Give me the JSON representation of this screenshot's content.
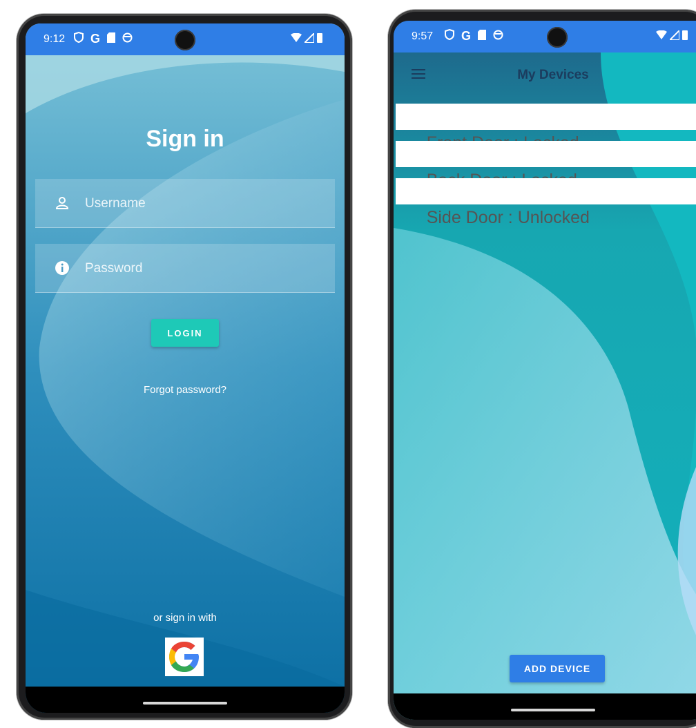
{
  "left_screen": {
    "status_bar": {
      "time": "9:12",
      "icons": [
        "shield-icon",
        "google-g-icon",
        "sd-card-icon",
        "circle-icon"
      ],
      "right_icons": [
        "wifi-icon",
        "signal-icon",
        "battery-icon"
      ]
    },
    "title": "Sign in",
    "username_placeholder": "Username",
    "password_placeholder": "Password",
    "login_label": "LOGIN",
    "forgot_password": "Forgot password?",
    "or_sign_in_with": "or sign in with",
    "google_button_icon": "google-logo-icon"
  },
  "right_screen": {
    "status_bar": {
      "time": "9:57",
      "icons": [
        "shield-icon",
        "google-g-icon",
        "sd-card-icon",
        "circle-icon"
      ],
      "right_icons": [
        "wifi-icon",
        "signal-icon",
        "battery-icon"
      ]
    },
    "app_bar": {
      "menu_icon": "hamburger-menu-icon",
      "title": "My Devices"
    },
    "devices": [
      {
        "name": "Front Door",
        "separator": " : ",
        "status": "Locked"
      },
      {
        "name": "Back Door",
        "separator": " : ",
        "status": "Locked"
      },
      {
        "name": "Side Door",
        "separator": " : ",
        "status": "Unlocked"
      }
    ],
    "add_device_label": "ADD DEVICE"
  },
  "colors": {
    "status_bar": "#2f7ee6",
    "login_button": "#1ec9b7",
    "add_device_button": "#2f7ee6",
    "app_bar_title": "#1b3c5e"
  }
}
